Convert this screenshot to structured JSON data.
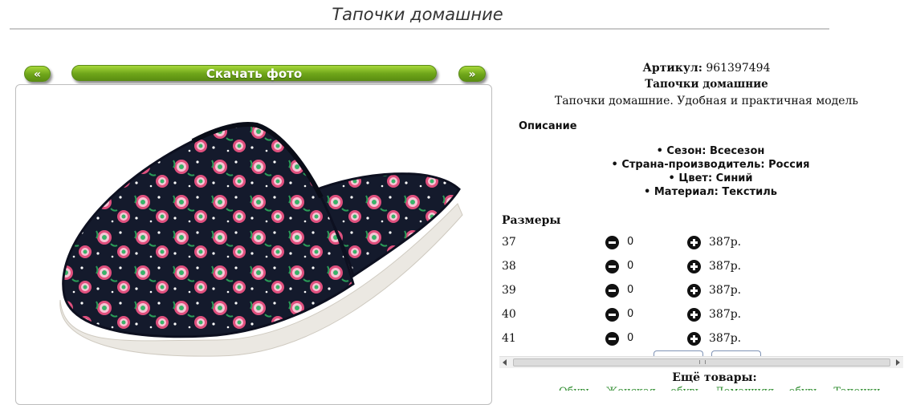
{
  "page": {
    "title": "Тапочки домашние"
  },
  "gallery": {
    "prev_label": "«",
    "download_label": "Скачать фото",
    "next_label": "»"
  },
  "product": {
    "article_label": "Артикул:",
    "article_value": "961397494",
    "name": "Тапочки домашние",
    "subtitle": "Тапочки домашние. Удобная и практичная модель",
    "description_heading": "Описание",
    "properties": [
      "Сезон: Всесезон",
      "Страна-производитель: Россия",
      "Цвет: Синий",
      "Материал: Текстиль"
    ]
  },
  "sizes": {
    "heading": "Размеры",
    "rows": [
      {
        "size": "37",
        "qty": "0",
        "price": "387р."
      },
      {
        "size": "38",
        "qty": "0",
        "price": "387р."
      },
      {
        "size": "39",
        "qty": "0",
        "price": "387р."
      },
      {
        "size": "40",
        "qty": "0",
        "price": "387р."
      },
      {
        "size": "41",
        "qty": "0",
        "price": "387р."
      }
    ]
  },
  "more": {
    "heading": "Ещё товары:",
    "links_text": "Обувь Женская обувь Домашняя обувь Тапочки"
  },
  "colors": {
    "pill_green": "#7ab51d",
    "slipper_body": "#141a2c",
    "sole": "#ebe8e2",
    "flower_pink": "#e0507e",
    "link_green": "#2a8a2a"
  }
}
